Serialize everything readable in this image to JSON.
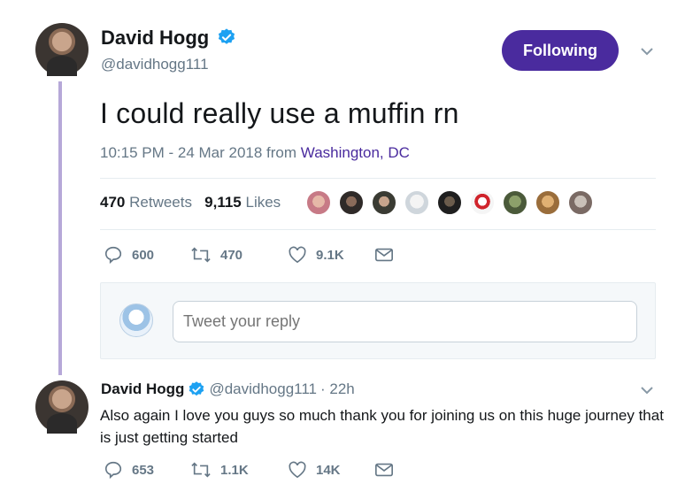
{
  "tweet": {
    "author_name": "David Hogg",
    "author_handle": "@davidhogg111",
    "follow_label": "Following",
    "text": "I could really use a muffin rn",
    "time": "10:15 PM - 24 Mar 2018 from ",
    "location": "Washington, DC",
    "retweets_count": "470",
    "retweets_label": "Retweets",
    "likes_count": "9,115",
    "likes_label": "Likes",
    "actions": {
      "replies": "600",
      "retweets": "470",
      "likes": "9.1K"
    }
  },
  "reply_box": {
    "placeholder": "Tweet your reply"
  },
  "reply": {
    "author_name": "David Hogg",
    "author_handle": "@davidhogg111",
    "time": "· 22h",
    "text": "Also again I love you guys so much thank you for joining us on this huge journey that is just getting started",
    "actions": {
      "replies": "653",
      "retweets": "1.1K",
      "likes": "14K"
    }
  },
  "colors": {
    "brand": "#4a2b9e",
    "verified": "#1da1f2",
    "muted": "#657786"
  }
}
